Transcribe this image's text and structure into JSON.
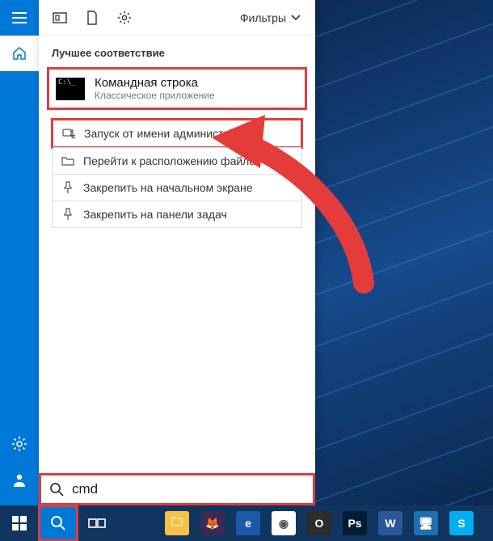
{
  "header": {
    "filters_label": "Фильтры"
  },
  "section_title": "Лучшее соответствие",
  "best_match": {
    "title": "Командная строка",
    "subtitle": "Классическое приложение",
    "thumb_text": "C:\\_"
  },
  "context_menu": [
    {
      "icon": "admin-shield-icon",
      "label": "Запуск от имени администратора",
      "highlight": true
    },
    {
      "icon": "folder-open-icon",
      "label": "Перейти к расположению файла",
      "highlight": false
    },
    {
      "icon": "pin-start-icon",
      "label": "Закрепить на начальном экране",
      "highlight": false
    },
    {
      "icon": "pin-taskbar-icon",
      "label": "Закрепить на панели задач",
      "highlight": false
    }
  ],
  "search": {
    "value": "cmd",
    "placeholder": ""
  },
  "taskbar": {
    "apps": [
      {
        "name": "file-explorer-icon",
        "bg": "#f8c146",
        "glyph": "🗀"
      },
      {
        "name": "firefox-icon",
        "bg": "#3a2a55",
        "glyph": "🦊"
      },
      {
        "name": "edge-icon",
        "bg": "#1a5aa8",
        "glyph": "e"
      },
      {
        "name": "chrome-icon",
        "bg": "#ffffff",
        "glyph": "◉"
      },
      {
        "name": "opera-icon",
        "bg": "#2c2c2c",
        "glyph": "O"
      },
      {
        "name": "photoshop-icon",
        "bg": "#001d34",
        "glyph": "Ps"
      },
      {
        "name": "word-icon",
        "bg": "#2b579a",
        "glyph": "W"
      },
      {
        "name": "remote-icon",
        "bg": "#1f6fb2",
        "glyph": "🖥"
      },
      {
        "name": "skype-icon",
        "bg": "#00aff0",
        "glyph": "S"
      }
    ]
  }
}
